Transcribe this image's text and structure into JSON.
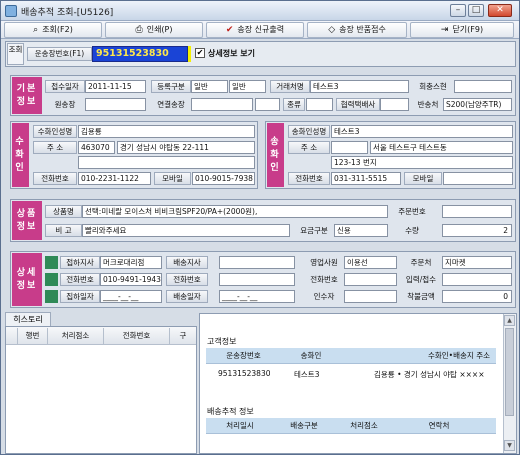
{
  "window": {
    "title": "배송추적 조회-[U5126]",
    "min": "–",
    "max": "□",
    "close": "✕"
  },
  "toolbar": [
    {
      "label": "조회(F2)",
      "icon": "search-icon",
      "glyph": "⌕"
    },
    {
      "label": "인쇄(P)",
      "icon": "printer-icon",
      "glyph": "⎙"
    },
    {
      "label": "송장 신규출력",
      "icon": "checkmark-icon",
      "glyph": "✔"
    },
    {
      "label": "송장 반품접수",
      "icon": "diamond-icon",
      "glyph": "◇"
    },
    {
      "label": "닫기(F9)",
      "icon": "door-icon",
      "glyph": "⇥"
    }
  ],
  "search": {
    "side": "조회",
    "label": "운송장번호(F1)",
    "value": "95131523830",
    "check": "✔",
    "detail_label": "상세정보 보기"
  },
  "basic": {
    "side": "기본정보",
    "label_date": "접수일자",
    "date": "2011-11-15",
    "label_regtype": "등록구분",
    "regtype": "일반",
    "regtype2": "일반",
    "label_client": "거래처명",
    "client": "테스트3",
    "label_count": "회충스현",
    "count": "",
    "label_original": "원송장",
    "original": "",
    "label_linked": "연결송장",
    "linked": "",
    "linked2": "",
    "label_type": "종류",
    "type": "",
    "label_partner": "협력택배사",
    "partner": "",
    "label_return": "반송처",
    "return_value": "S200(남양주TR)"
  },
  "receiver": {
    "side": "수화인",
    "label_name": "수화인성명",
    "name": "김용룡",
    "label_addr": "주 소",
    "zip": "463070",
    "addr1": "경기 성남시 야탑동 22-111",
    "addr2": "",
    "label_phone": "전화번호",
    "phone": "010-2231-1122",
    "label_mobile": "모바일",
    "mobile": "010-9015-7938"
  },
  "sender": {
    "side": "송화인",
    "label_name": "송화인성명",
    "name": "테스트3",
    "label_addr": "주 소",
    "zip": "",
    "addr1": "서울 테스트구 테스트동",
    "addr2": "123-13 번지",
    "label_phone": "전화번호",
    "phone": "031-311-5515",
    "label_mobile": "모바일",
    "mobile": ""
  },
  "product": {
    "side": "상품정보",
    "label_name": "상품명",
    "name": "선택:미네랄 모이스처 비비크림SPF20/PA+(2000원),",
    "label_order": "주문번호",
    "order": "",
    "label_note": "비 고",
    "note": "빨리와주세요",
    "label_fare": "요금구분",
    "fare": "신용",
    "label_qty": "수량",
    "qty": "2"
  },
  "detail": {
    "side": "상세정보",
    "label_rcv_branch": "접하지사",
    "rcv_branch": "머크로대리점",
    "label_dlv_branch": "배송지사",
    "dlv_branch": "",
    "label_sales": "영업사원",
    "sales": "이용선",
    "label_orderer": "주문처",
    "orderer": "지마켓",
    "label_phone1": "전화번호",
    "phone1": "010-9491-1943",
    "label_phone2": "전화번호",
    "phone2": "",
    "label_phone3": "전화번호",
    "phone3": "",
    "label_input": "입력/접수",
    "input": "",
    "label_pickup_date": "집하일자",
    "pickup_date": "____-__-__",
    "label_dlv_date": "배송일자",
    "dlv_date": "____-__-__",
    "label_taker": "인수자",
    "taker": "",
    "label_cod": "착불금액",
    "cod": "0"
  },
  "history": {
    "tab": "히스토리",
    "columns": [
      "행번",
      "처리점소",
      "전화번호",
      "구"
    ]
  },
  "customer": {
    "section": "고객정보",
    "columns": [
      "운송장번호",
      "송화인",
      "수화인•배송지 주소"
    ],
    "row": [
      "95131523830",
      "테스트3",
      "김용룡 • 경기 성남시 야탑 ××××"
    ]
  },
  "tracking": {
    "section": "배송추적 정보",
    "columns": [
      "처리일시",
      "배송구분",
      "처리점소",
      "연락처"
    ]
  }
}
